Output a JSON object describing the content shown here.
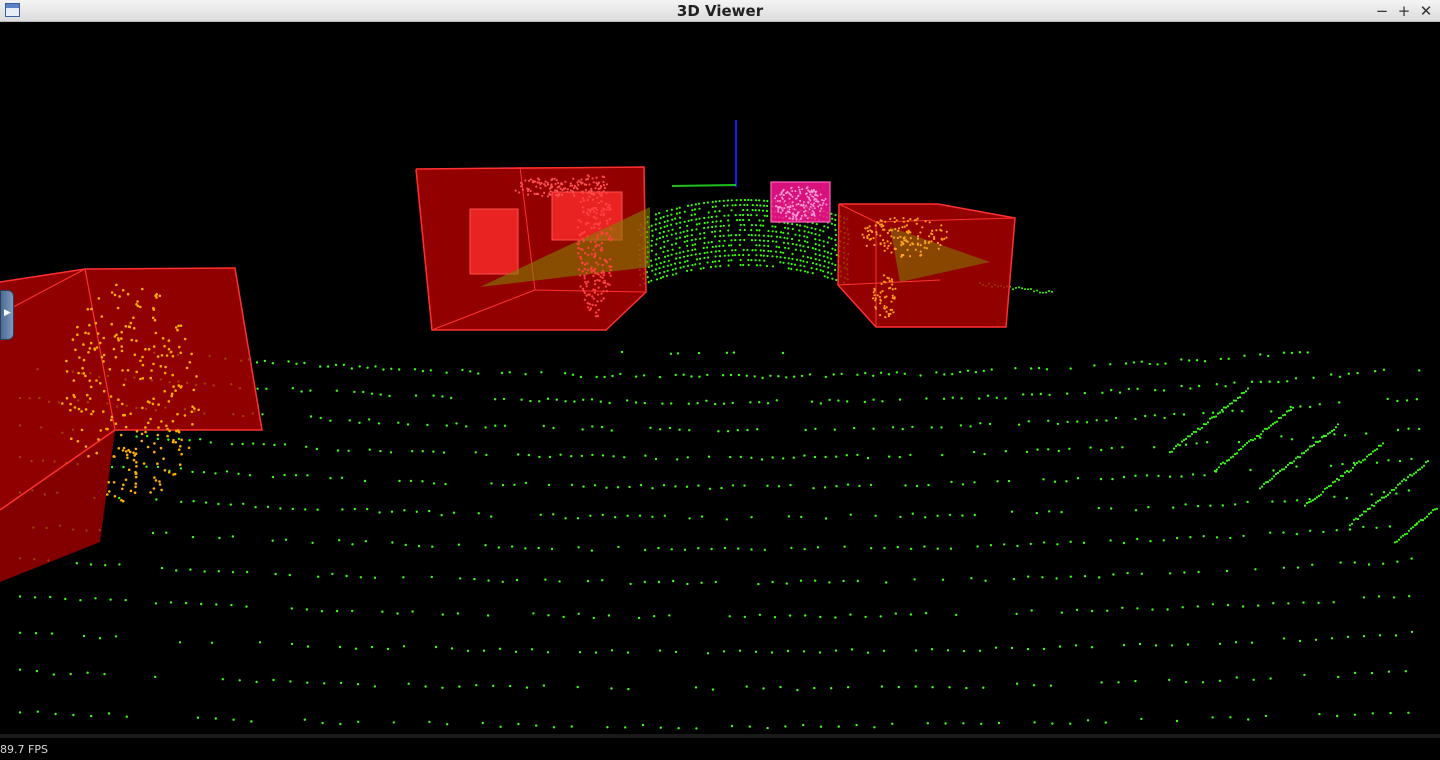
{
  "window": {
    "title": "3D Viewer",
    "minimize_label": "−",
    "maximize_label": "+",
    "close_label": "✕",
    "app_icon": "window-app-icon"
  },
  "viewport": {
    "fps_label": "89.7 FPS",
    "side_handle_icon": "expand-right-arrow-icon",
    "side_handle_glyph": "▶",
    "colors": {
      "background": "#000000",
      "ground_points": "#39ff14",
      "dense_points": "#33ff00",
      "box_fill": "#cc0000",
      "box_edge": "#ff2020",
      "object_points": "#ffb000",
      "target_box": "#ff1493",
      "axis_z": "#1a1aff",
      "axis_x": "#20c020"
    }
  }
}
